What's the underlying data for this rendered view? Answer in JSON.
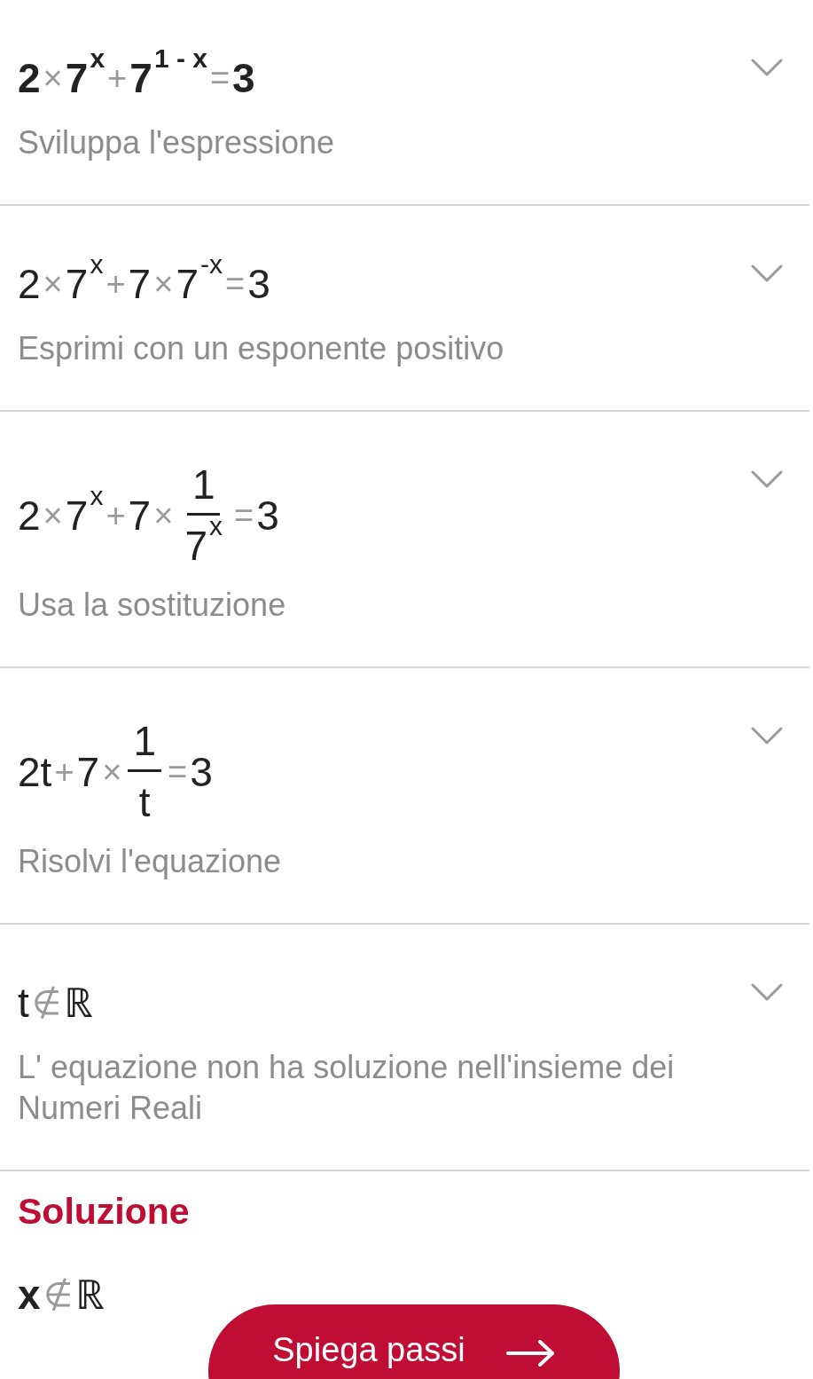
{
  "steps": [
    {
      "bold": true,
      "expanded": false,
      "expression": [
        {
          "kind": "term",
          "text": "2"
        },
        {
          "kind": "op",
          "text": "×"
        },
        {
          "kind": "term",
          "text": "7$^{x}$"
        },
        {
          "kind": "op",
          "text": "+"
        },
        {
          "kind": "term",
          "text": "7$^{1 - x}$"
        },
        {
          "kind": "op",
          "text": "="
        },
        {
          "kind": "term",
          "text": "3"
        }
      ],
      "description": "Sviluppa l'espressione"
    },
    {
      "bold": false,
      "expanded": false,
      "expression": [
        {
          "kind": "term",
          "text": "2"
        },
        {
          "kind": "op",
          "text": "×"
        },
        {
          "kind": "term",
          "text": "7$^{x}$"
        },
        {
          "kind": "op",
          "text": "+"
        },
        {
          "kind": "term",
          "text": "7"
        },
        {
          "kind": "op",
          "text": "×"
        },
        {
          "kind": "term",
          "text": "7$^{-x}$"
        },
        {
          "kind": "op",
          "text": "="
        },
        {
          "kind": "term",
          "text": "3"
        }
      ],
      "description": "Esprimi con un esponente positivo"
    },
    {
      "bold": false,
      "expanded": false,
      "expression": [
        {
          "kind": "term",
          "text": "2"
        },
        {
          "kind": "op",
          "text": "×"
        },
        {
          "kind": "term",
          "text": "7$^{x}$"
        },
        {
          "kind": "op",
          "text": "+"
        },
        {
          "kind": "term",
          "text": "7"
        },
        {
          "kind": "op",
          "text": "×"
        },
        {
          "kind": "frac",
          "numerator": "1",
          "denominator": "7$^{x}$"
        },
        {
          "kind": "op",
          "text": "="
        },
        {
          "kind": "term",
          "text": "3"
        }
      ],
      "description": "Usa la sostituzione"
    },
    {
      "bold": false,
      "expanded": false,
      "expression": [
        {
          "kind": "term",
          "text": "2t"
        },
        {
          "kind": "op",
          "text": "+"
        },
        {
          "kind": "term",
          "text": "7"
        },
        {
          "kind": "op",
          "text": "×"
        },
        {
          "kind": "frac",
          "numerator": "1",
          "denominator": "t"
        },
        {
          "kind": "op",
          "text": "="
        },
        {
          "kind": "term",
          "text": "3"
        }
      ],
      "description": "Risolvi l'equazione"
    },
    {
      "bold": false,
      "expanded": false,
      "expression": [
        {
          "kind": "term",
          "text": "t"
        },
        {
          "kind": "op",
          "text": "∉"
        },
        {
          "kind": "term",
          "text": "ℝ"
        }
      ],
      "description": "L' equazione non ha soluzione nell'insieme dei Numeri Reali"
    }
  ],
  "solution": {
    "title": "Soluzione",
    "expression": [
      {
        "kind": "term",
        "text": "**x**"
      },
      {
        "kind": "op",
        "text": "∉"
      },
      {
        "kind": "term",
        "text": "ℝ"
      }
    ]
  },
  "explain_button": {
    "label": "Spiega passi"
  }
}
